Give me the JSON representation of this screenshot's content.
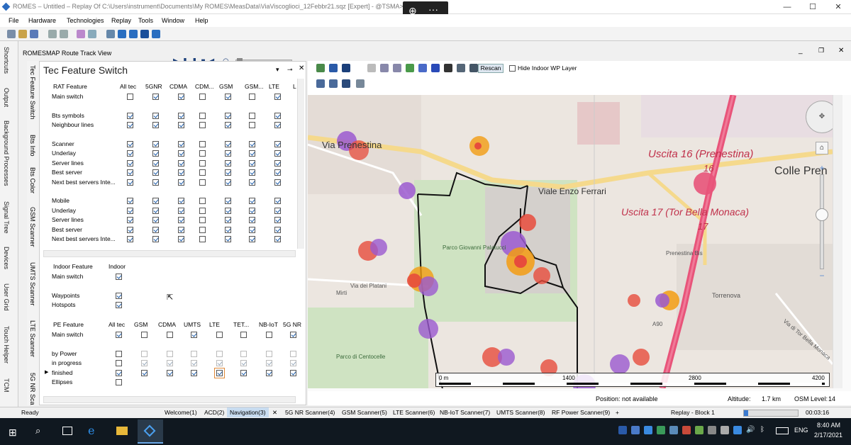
{
  "window": {
    "title": "ROMES – Untitled – Replay Of C:\\Users\\instrument\\Documents\\My ROMES\\MeasData\\ViaViscoglioci_12Febbr21.sqz [Expert] - @TSMA>"
  },
  "overlay": {
    "zoom_icon": "⊕",
    "more": "···"
  },
  "menu": [
    "File",
    "Hardware",
    "Technologies",
    "Replay",
    "Tools",
    "Window",
    "Help"
  ],
  "left_tabs": [
    "Shortcuts",
    "Output",
    "Background Processes",
    "Signal Tree",
    "Devices",
    "User Grid",
    "Touch Helper",
    "TCM"
  ],
  "view_title": "ROMESMAP Route Track View",
  "panel": {
    "title": "Tec Feature Switch",
    "side_tabs": [
      "Tec Feature Switch",
      "Bts Info",
      "Bts Color",
      "GSM Scanner",
      "UMTS Scanner",
      "LTE Scanner",
      "5G NR Sca"
    ],
    "rat": {
      "headers": [
        "RAT Feature",
        "All tec",
        "5GNR",
        "CDMA",
        "CDM...",
        "GSM",
        "GSM...",
        "LTE",
        "L"
      ],
      "rows": [
        {
          "label": "Main switch",
          "checks": [
            false,
            true,
            true,
            false,
            true,
            false,
            true
          ]
        },
        {
          "label": "",
          "checks": null
        },
        {
          "label": "Bts symbols",
          "checks": [
            true,
            true,
            true,
            false,
            true,
            false,
            true
          ]
        },
        {
          "label": "Neighbour lines",
          "checks": [
            true,
            true,
            true,
            false,
            true,
            false,
            true
          ]
        },
        {
          "label": "",
          "checks": null
        },
        {
          "label": "Scanner",
          "checks": [
            true,
            true,
            true,
            false,
            true,
            true,
            true
          ]
        },
        {
          "label": "Underlay",
          "checks": [
            true,
            true,
            true,
            false,
            true,
            true,
            true
          ]
        },
        {
          "label": "Server lines",
          "checks": [
            true,
            true,
            true,
            false,
            true,
            true,
            true
          ]
        },
        {
          "label": "Best server",
          "checks": [
            true,
            true,
            true,
            false,
            true,
            true,
            true
          ]
        },
        {
          "label": "Next best servers Inte...",
          "checks": [
            true,
            true,
            true,
            false,
            true,
            true,
            true
          ]
        },
        {
          "label": "",
          "checks": null
        },
        {
          "label": "Mobile",
          "checks": [
            true,
            true,
            true,
            false,
            true,
            true,
            true
          ]
        },
        {
          "label": "Underlay",
          "checks": [
            true,
            true,
            true,
            false,
            true,
            true,
            true
          ]
        },
        {
          "label": "Server lines",
          "checks": [
            true,
            true,
            true,
            false,
            true,
            true,
            true
          ]
        },
        {
          "label": "Best server",
          "checks": [
            true,
            true,
            true,
            false,
            true,
            true,
            true
          ]
        },
        {
          "label": "Next best servers Inte...",
          "checks": [
            true,
            true,
            true,
            false,
            true,
            true,
            true
          ]
        }
      ]
    },
    "indoor": {
      "headers": [
        "Indoor Feature",
        "Indoor"
      ],
      "rows": [
        {
          "label": "Main switch",
          "on": true
        },
        {
          "label": "",
          "on": null
        },
        {
          "label": "Waypoints",
          "on": true
        },
        {
          "label": "Hotspots",
          "on": true
        }
      ]
    },
    "pe": {
      "headers": [
        "PE Feature",
        "All tec",
        "GSM",
        "CDMA",
        "UMTS",
        "LTE",
        "TET...",
        "NB-IoT",
        "5G NR"
      ],
      "rows": [
        {
          "label": "Main switch",
          "checks": [
            true,
            false,
            false,
            true,
            false,
            false,
            false,
            true
          ]
        },
        {
          "label": "",
          "checks": null
        },
        {
          "label": "by Power",
          "checks": [
            false,
            false,
            false,
            false,
            false,
            false,
            false,
            false
          ]
        },
        {
          "label": "in progress",
          "checks": [
            false,
            true,
            true,
            true,
            true,
            true,
            true,
            true
          ]
        },
        {
          "label": "finished",
          "checks": [
            true,
            true,
            true,
            true,
            true,
            true,
            true,
            true
          ]
        },
        {
          "label": "Ellipses",
          "checks": [
            false,
            null,
            null,
            null,
            null,
            null,
            null,
            null
          ]
        }
      ]
    }
  },
  "map_toolbar": {
    "rescan": "Rescan",
    "hide_indoor": "Hide Indoor WP Layer"
  },
  "map": {
    "labels": [
      {
        "text": "Via Prenestina",
        "cls": "road"
      },
      {
        "text": "Viale Enzo Ferrari",
        "cls": "road"
      },
      {
        "text": "Uscita 16 (Prenestina)",
        "cls": "exit"
      },
      {
        "text": "16",
        "cls": "exit2"
      },
      {
        "text": "Colle Pren",
        "cls": "place"
      },
      {
        "text": "Uscita 17 (Tor Bella Monaca)",
        "cls": "exit"
      },
      {
        "text": "17",
        "cls": "exit2"
      },
      {
        "text": "Parco Giovanni Palatucci",
        "cls": "park"
      },
      {
        "text": "Prenestina Bis",
        "cls": "small"
      },
      {
        "text": "Torrenova",
        "cls": "small"
      },
      {
        "text": "Via dei Platani",
        "cls": "small"
      },
      {
        "text": "Mirti",
        "cls": "small"
      },
      {
        "text": "Parco di Centocelle",
        "cls": "park"
      },
      {
        "text": "A90",
        "cls": "small"
      },
      {
        "text": "Via di Tor Bella Monaca",
        "cls": "small"
      }
    ],
    "scale": [
      "0 m",
      "1400",
      "2800",
      "4200"
    ],
    "zoom_plus": "+",
    "zoom_minus": "−"
  },
  "map_status": {
    "position": "Position: not available",
    "altitude_label": "Altitude:",
    "altitude": "1.7 km",
    "osm_label": "OSM Level:",
    "osm": "14"
  },
  "status": {
    "ready": "Ready",
    "tabs": [
      "Welcome(1)",
      "ACD(2)",
      "Navigation(3)",
      "5G NR Scanner(4)",
      "GSM Scanner(5)",
      "LTE Scanner(6)",
      "NB-IoT Scanner(7)",
      "UMTS Scanner(8)",
      "RF Power Scanner(9)",
      "+"
    ],
    "replay": "Replay - Block 1",
    "time": "00:03:16"
  },
  "taskbar": {
    "lang": "ENG",
    "time": "8:40 AM",
    "date": "2/17/2021"
  },
  "colors": {
    "accent": "#1a5aa8",
    "taskbar": "#101820",
    "motorway": "#e8547a"
  }
}
